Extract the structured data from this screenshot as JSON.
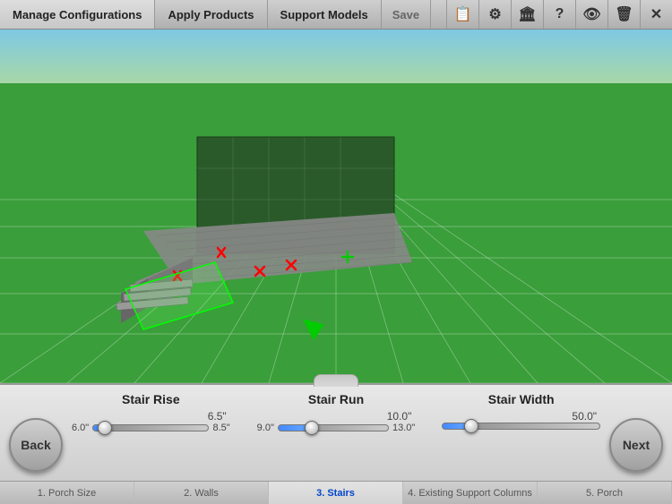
{
  "nav": {
    "tabs": [
      {
        "label": "Manage Configurations"
      },
      {
        "label": "Apply Products"
      },
      {
        "label": "Support Models"
      }
    ],
    "save_label": "Save",
    "icons": [
      {
        "name": "clipboard-icon",
        "glyph": "📋"
      },
      {
        "name": "settings-icon",
        "glyph": "⚙"
      },
      {
        "name": "building-icon",
        "glyph": "🏛"
      },
      {
        "name": "help-icon",
        "glyph": "?"
      },
      {
        "name": "eye-icon",
        "glyph": "👁"
      },
      {
        "name": "trash-icon",
        "glyph": "🗑"
      },
      {
        "name": "close-icon",
        "glyph": "✕"
      }
    ]
  },
  "sliders": [
    {
      "label": "Stair Rise",
      "max_value": "6.5\"",
      "min_value": "6.0\"",
      "track_max": "8.5\"",
      "fill_pct": 10
    },
    {
      "label": "Stair Run",
      "max_value": "10.0\"",
      "min_value": "9.0\"",
      "track_max": "13.0\"",
      "fill_pct": 30
    },
    {
      "label": "Stair Width",
      "max_value": "50.0\"",
      "min_value": "",
      "track_max": "",
      "fill_pct": 18
    }
  ],
  "buttons": {
    "back": "Back",
    "next": "Next"
  },
  "step_tabs": [
    {
      "label": "1. Porch Size",
      "active": false
    },
    {
      "label": "2. Walls",
      "active": false
    },
    {
      "label": "3. Stairs",
      "active": true
    },
    {
      "label": "4. Existing Support Columns",
      "active": false
    },
    {
      "label": "5. Porch",
      "active": false
    }
  ]
}
